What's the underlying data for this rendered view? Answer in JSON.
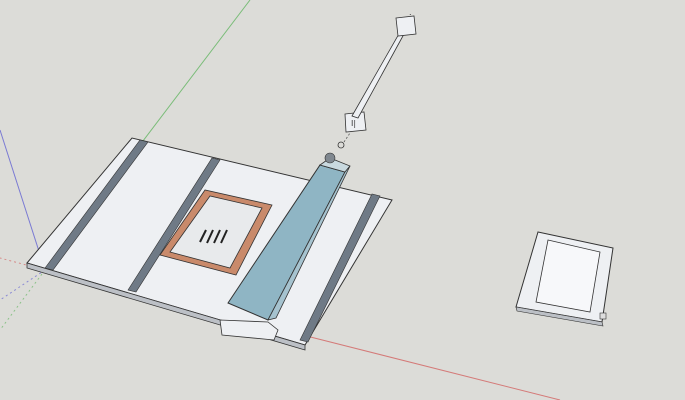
{
  "app": {
    "window_title": "",
    "background_color": "#dcdcd8"
  },
  "axes": {
    "red_axis_color": "#d03a3a",
    "green_axis_color": "#3aa83a",
    "blue_axis_color": "#3a3ad0"
  },
  "model": {
    "fence_color": "#8fb5c4",
    "panel_color": "#eef0f3",
    "slot_color": "#6f7a86",
    "insert_frame_color": "#c98a6b"
  },
  "labels": {
    "marker": "I|",
    "dot": "."
  }
}
